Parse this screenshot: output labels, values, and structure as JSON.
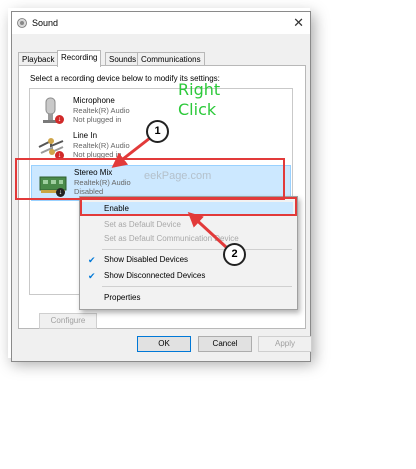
{
  "window": {
    "title": "Sound",
    "close_glyph": "✕"
  },
  "tabs": [
    {
      "label": "Playback"
    },
    {
      "label": "Recording"
    },
    {
      "label": "Sounds"
    },
    {
      "label": "Communications"
    }
  ],
  "instruction": "Select a recording device below to modify its settings:",
  "devices": [
    {
      "name": "Microphone",
      "driver": "Realtek(R) Audio",
      "status": "Not plugged in",
      "icon": "microphone-icon"
    },
    {
      "name": "Line In",
      "driver": "Realtek(R) Audio",
      "status": "Not plugged in",
      "icon": "line-in-icon"
    },
    {
      "name": "Stereo Mix",
      "driver": "Realtek(R) Audio",
      "status": "Disabled",
      "icon": "sound-card-icon"
    }
  ],
  "watermark": "eekPage.com",
  "context_menu": {
    "enable": "Enable",
    "set_default_device": "Set as Default Device",
    "set_default_comm": "Set as Default Communication Device",
    "show_disabled": "Show Disabled Devices",
    "show_disconnected": "Show Disconnected Devices",
    "properties": "Properties"
  },
  "buttons": {
    "configure": "Configure",
    "ok": "OK",
    "cancel": "Cancel",
    "apply": "Apply"
  },
  "annotations": {
    "right_click": "Right\nClick",
    "step1": "1",
    "step2": "2"
  },
  "colors": {
    "highlight": "#e23a3a",
    "annotation_text": "#2cc93a",
    "selection": "#cce8ff"
  }
}
